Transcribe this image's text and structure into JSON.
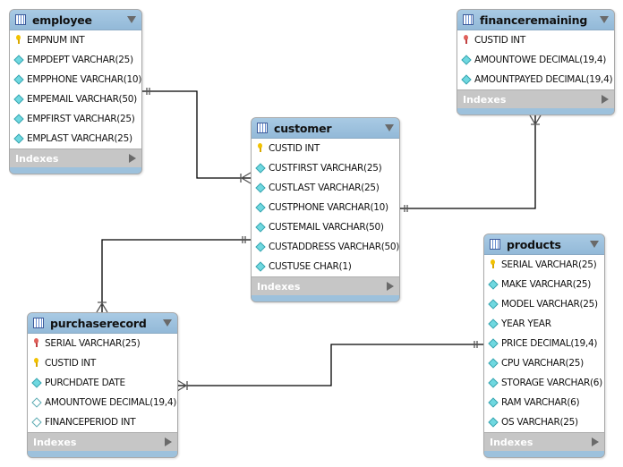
{
  "colors": {
    "header": "#9dc1dc",
    "indexes": "#c6c6c6",
    "pk_key": "#f2c200",
    "fk_key": "#e0605a",
    "column_diamond": "#6fd8e0"
  },
  "indexes_label": "Indexes",
  "tables": [
    {
      "id": "employee",
      "name": "employee",
      "columns": [
        {
          "icon": "key",
          "text": "EMPNUM INT"
        },
        {
          "icon": "dia",
          "text": "EMPDEPT VARCHAR(25)"
        },
        {
          "icon": "dia",
          "text": "EMPPHONE VARCHAR(10)"
        },
        {
          "icon": "dia",
          "text": "EMPEMAIL VARCHAR(50)"
        },
        {
          "icon": "dia",
          "text": "EMPFIRST VARCHAR(25)"
        },
        {
          "icon": "dia",
          "text": "EMPLAST VARCHAR(25)"
        }
      ]
    },
    {
      "id": "financeremaining",
      "name": "financeremaining",
      "columns": [
        {
          "icon": "fkey",
          "text": "CUSTID INT"
        },
        {
          "icon": "dia",
          "text": "AMOUNTOWE DECIMAL(19,4)"
        },
        {
          "icon": "dia",
          "text": "AMOUNTPAYED DECIMAL(19,4)"
        }
      ]
    },
    {
      "id": "customer",
      "name": "customer",
      "columns": [
        {
          "icon": "key",
          "text": "CUSTID INT"
        },
        {
          "icon": "dia",
          "text": "CUSTFIRST VARCHAR(25)"
        },
        {
          "icon": "dia",
          "text": "CUSTLAST VARCHAR(25)"
        },
        {
          "icon": "dia",
          "text": "CUSTPHONE VARCHAR(10)"
        },
        {
          "icon": "dia",
          "text": "CUSTEMAIL VARCHAR(50)"
        },
        {
          "icon": "dia",
          "text": "CUSTADDRESS VARCHAR(50)"
        },
        {
          "icon": "dia",
          "text": "CUSTUSE CHAR(1)"
        }
      ]
    },
    {
      "id": "products",
      "name": "products",
      "columns": [
        {
          "icon": "key",
          "text": "SERIAL VARCHAR(25)"
        },
        {
          "icon": "dia",
          "text": "MAKE VARCHAR(25)"
        },
        {
          "icon": "dia",
          "text": "MODEL VARCHAR(25)"
        },
        {
          "icon": "dia",
          "text": "YEAR YEAR"
        },
        {
          "icon": "dia",
          "text": "PRICE DECIMAL(19,4)"
        },
        {
          "icon": "dia",
          "text": "CPU VARCHAR(25)"
        },
        {
          "icon": "dia",
          "text": "STORAGE VARCHAR(6)"
        },
        {
          "icon": "dia",
          "text": "RAM VARCHAR(6)"
        },
        {
          "icon": "dia",
          "text": "OS VARCHAR(25)"
        }
      ]
    },
    {
      "id": "purchaserecord",
      "name": "purchaserecord",
      "columns": [
        {
          "icon": "fkey",
          "text": "SERIAL VARCHAR(25)"
        },
        {
          "icon": "key",
          "text": "CUSTID INT"
        },
        {
          "icon": "dia",
          "text": "PURCHDATE DATE"
        },
        {
          "icon": "dia-o",
          "text": "AMOUNTOWE DECIMAL(19,4)"
        },
        {
          "icon": "dia-o",
          "text": "FINANCEPERIOD INT"
        }
      ]
    }
  ],
  "relationships": [
    {
      "from": "employee",
      "to": "customer",
      "from_card": "one",
      "to_card": "many"
    },
    {
      "from": "customer",
      "to": "financeremaining",
      "from_card": "one",
      "to_card": "many"
    },
    {
      "from": "customer",
      "to": "purchaserecord",
      "from_card": "one",
      "to_card": "many"
    },
    {
      "from": "products",
      "to": "purchaserecord",
      "from_card": "one",
      "to_card": "many"
    }
  ]
}
